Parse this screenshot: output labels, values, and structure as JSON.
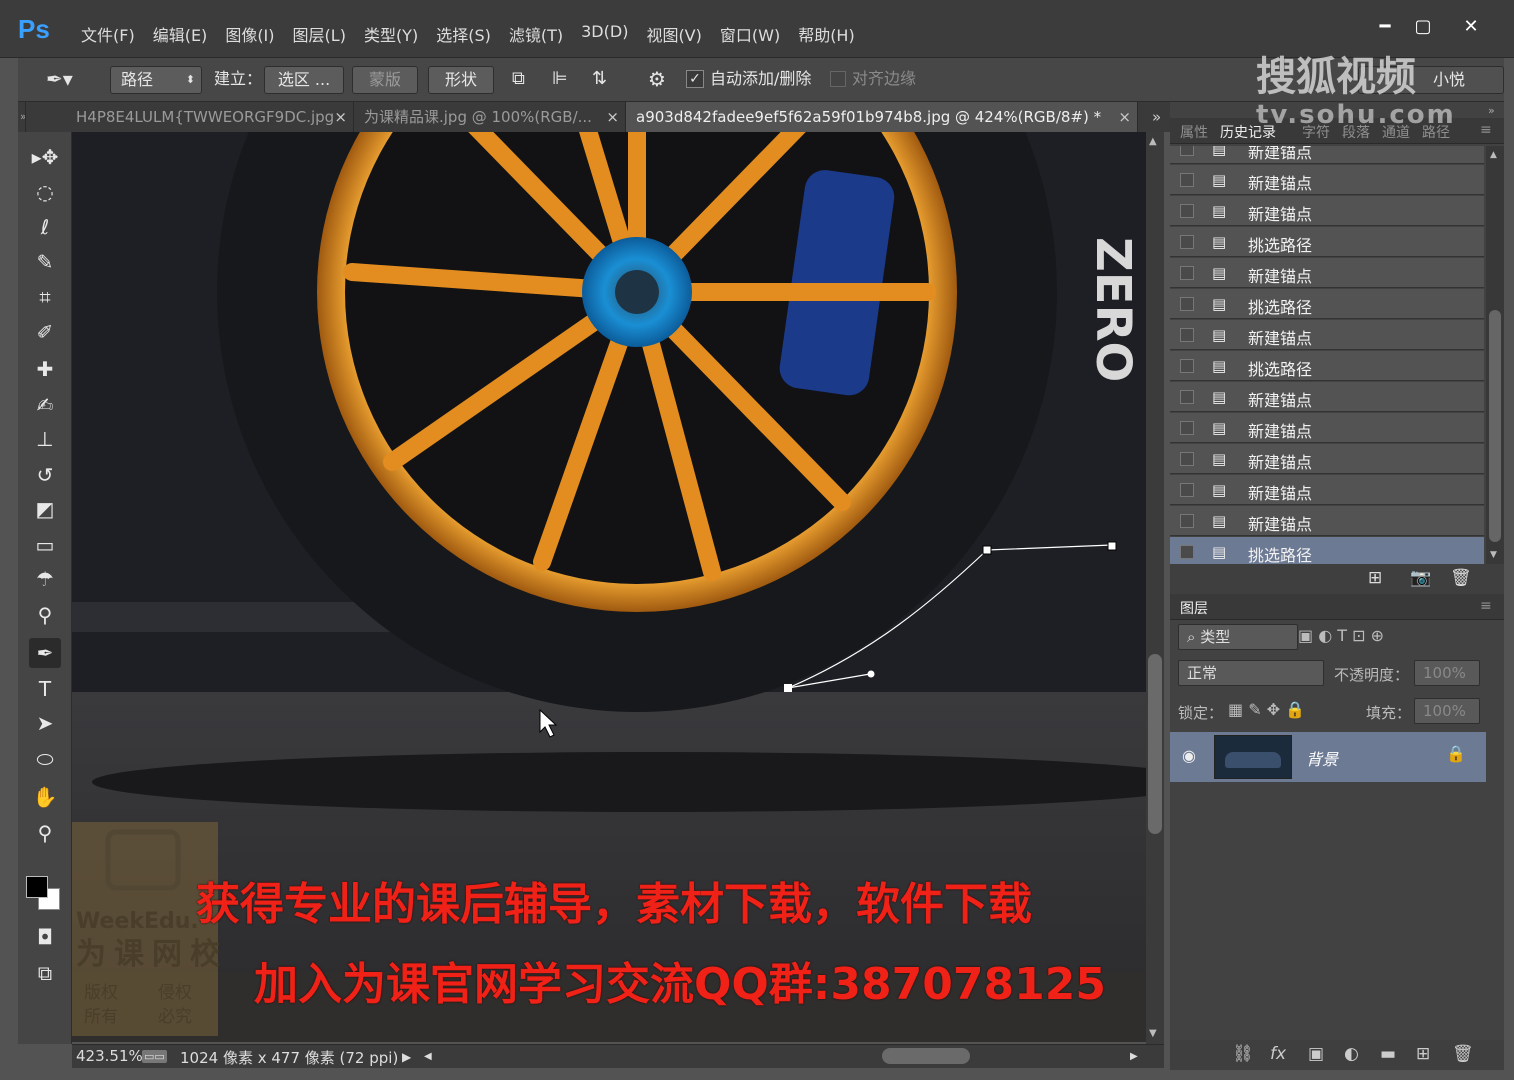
{
  "app": {
    "logo": "Ps",
    "menus": [
      "文件(F)",
      "编辑(E)",
      "图像(I)",
      "图层(L)",
      "类型(Y)",
      "选择(S)",
      "滤镜(T)",
      "3D(D)",
      "视图(V)",
      "窗口(W)",
      "帮助(H)"
    ],
    "window_buttons": {
      "minimize": "━",
      "maximize": "▢",
      "close": "✕"
    }
  },
  "options": {
    "mode_select": "路径",
    "build_label": "建立：",
    "selection_btn": "选区 ...",
    "mask_btn": "蒙版",
    "shape_btn": "形状",
    "auto_add_delete": "自动添加/删除",
    "auto_checked": true,
    "align_edges": "对齐边缘",
    "user_label": "小悦"
  },
  "tabs": [
    {
      "label": "H4P8E4LULM{TWWEORGF9DC.jpg",
      "close": "×"
    },
    {
      "label": "为课精品课.jpg @ 100%(RGB/...",
      "close": "×"
    },
    {
      "label": "a903d842fadee9ef5f62a59f01b974b8.jpg @ 424%(RGB/8#) *",
      "close": "×"
    }
  ],
  "tools": [
    "move-tool",
    "marquee-tool",
    "lasso-tool",
    "quick-select-tool",
    "crop-tool",
    "eyedropper-tool",
    "healing-tool",
    "brush-tool",
    "stamp-tool",
    "history-brush-tool",
    "eraser-tool",
    "gradient-tool",
    "blur-tool",
    "dodge-tool",
    "pen-tool",
    "type-tool",
    "path-select-tool",
    "ellipse-tool",
    "hand-tool",
    "zoom-tool"
  ],
  "canvas": {
    "tire_text": "ZERO",
    "overlay_line1": "获得专业的课后辅导，素材下载，软件下载",
    "overlay_line2": "加入为课官网学习交流QQ群:387078125",
    "watermark_brand": "WeekEdu.",
    "watermark_cn": "为课网校",
    "watermark_small": [
      "版权",
      "侵权",
      "所有",
      "必究"
    ]
  },
  "status": {
    "zoom": "423.51%",
    "doc_info": "1024 像素 x 477 像素 (72 ppi)"
  },
  "history_panel": {
    "tabs": [
      "属性",
      "历史记录",
      "字符",
      "段落",
      "通道",
      "路径"
    ],
    "active_tab": "历史记录",
    "items": [
      {
        "label": "新建锚点"
      },
      {
        "label": "新建锚点"
      },
      {
        "label": "新建锚点"
      },
      {
        "label": "挑选路径"
      },
      {
        "label": "新建锚点"
      },
      {
        "label": "挑选路径"
      },
      {
        "label": "新建锚点"
      },
      {
        "label": "挑选路径"
      },
      {
        "label": "新建锚点"
      },
      {
        "label": "新建锚点"
      },
      {
        "label": "新建锚点"
      },
      {
        "label": "新建锚点"
      },
      {
        "label": "新建锚点"
      },
      {
        "label": "挑选路径"
      }
    ],
    "selected_index": 13
  },
  "layers_panel": {
    "title": "图层",
    "filter": "类型",
    "blend_mode": "正常",
    "opacity_label": "不透明度：",
    "opacity_value": "100%",
    "lock_label": "锁定：",
    "fill_label": "填充：",
    "fill_value": "100%",
    "layers": [
      {
        "name": "背景",
        "visible": true,
        "locked": true
      }
    ]
  },
  "watermark_site": {
    "brand": "搜狐视频",
    "url": "tv.sohu.com"
  }
}
